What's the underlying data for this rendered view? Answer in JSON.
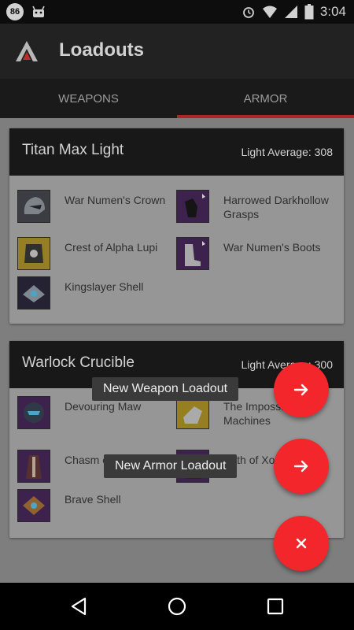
{
  "status": {
    "badge": "86",
    "time": "3:04"
  },
  "app": {
    "title": "Loadouts"
  },
  "tabs": [
    {
      "label": "WEAPONS"
    },
    {
      "label": "ARMOR"
    }
  ],
  "loadouts": [
    {
      "title": "Titan Max Light",
      "light": "Light Average: 308",
      "items": [
        {
          "name": "War Numen's Crown"
        },
        {
          "name": "Harrowed Darkhollow Grasps"
        },
        {
          "name": "Crest of Alpha Lupi"
        },
        {
          "name": "War Numen's Boots"
        },
        {
          "name": "Kingslayer Shell"
        }
      ]
    },
    {
      "title": "Warlock Crucible",
      "light": "Light Average: 300",
      "items": [
        {
          "name": "Devouring Maw"
        },
        {
          "name": "The Impossible Machines"
        },
        {
          "name": "Chasm of Yool"
        },
        {
          "name": "Path of Xol"
        },
        {
          "name": "Brave Shell"
        }
      ]
    }
  ],
  "fab": {
    "new_weapon_label": "New Weapon Loadout",
    "new_armor_label": "New Armor Loadout"
  }
}
